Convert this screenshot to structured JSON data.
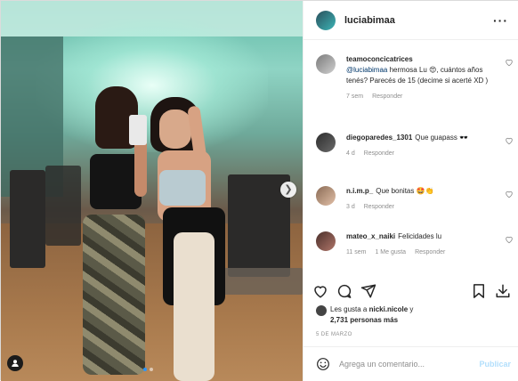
{
  "post": {
    "owner": "luciabimaa",
    "more_icon": "more-horizontal-icon",
    "carousel": {
      "current_index": 1,
      "total": 2
    }
  },
  "comments": [
    {
      "author": "teamoconcicatrices",
      "mention": "@luciabimaa",
      "text": " hermosa Lu 😍, cuántos años tenés? Parecés de 15 (decime si acerté XD )",
      "time": "7 sem",
      "reply": "Responder",
      "likes": ""
    },
    {
      "author": "diegoparedes_1301",
      "mention": "",
      "text": "Que guapass 🕶️",
      "time": "4 d",
      "reply": "Responder",
      "likes": ""
    },
    {
      "author": "n.i.m.p_",
      "mention": "",
      "text": "Que bonitas 🤩👏",
      "time": "3 d",
      "reply": "Responder",
      "likes": ""
    },
    {
      "author": "mateo_x_naiki",
      "mention": "",
      "text": "Felicidades lu",
      "time": "11 sem",
      "reply": "Responder",
      "likes": "1 Me gusta"
    }
  ],
  "actions": {
    "like_icon": "heart-icon",
    "comment_icon": "comment-icon",
    "share_icon": "send-icon",
    "save_icon": "bookmark-icon",
    "download_icon": "download-icon"
  },
  "likes": {
    "prefix": "Les gusta a ",
    "user": "nicki.nicole",
    "middle": " y",
    "count": "2,731 personas más"
  },
  "date": "5 DE MARZO",
  "add_comment": {
    "placeholder": "Agrega un comentario...",
    "publish_label": "Publicar"
  },
  "colors": {
    "link": "#00376b",
    "publish_disabled": "#b2dffc",
    "meta": "#8e8e8e",
    "carousel_active": "#2f95f6"
  }
}
